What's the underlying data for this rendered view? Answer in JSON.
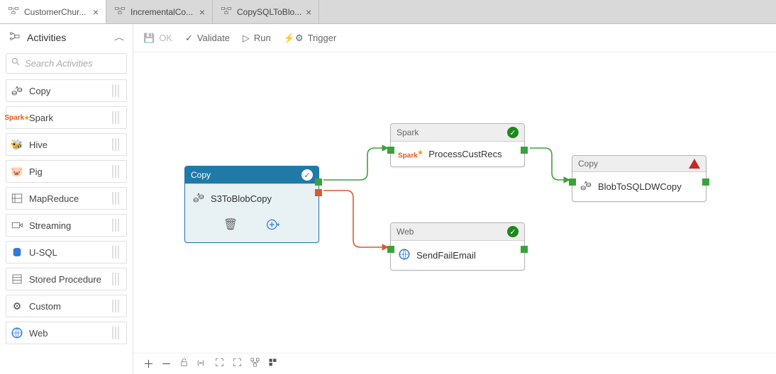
{
  "tabs": [
    {
      "label": "CustomerChur...",
      "closable": true,
      "active": true
    },
    {
      "label": "IncrementalCo...",
      "closable": true,
      "active": false
    },
    {
      "label": "CopySQLToBlo...",
      "closable": true,
      "active": false
    }
  ],
  "sidebar": {
    "title": "Activities",
    "search_placeholder": "Search Activities",
    "items": [
      {
        "label": "Copy",
        "icon": "copy"
      },
      {
        "label": "Spark",
        "icon": "spark"
      },
      {
        "label": "Hive",
        "icon": "hive"
      },
      {
        "label": "Pig",
        "icon": "pig"
      },
      {
        "label": "MapReduce",
        "icon": "mapreduce"
      },
      {
        "label": "Streaming",
        "icon": "streaming"
      },
      {
        "label": "U-SQL",
        "icon": "usql"
      },
      {
        "label": "Stored Procedure",
        "icon": "sproc"
      },
      {
        "label": "Custom",
        "icon": "custom"
      },
      {
        "label": "Web",
        "icon": "web"
      }
    ]
  },
  "toolbar": {
    "ok": "OK",
    "validate": "Validate",
    "run": "Run",
    "trigger": "Trigger"
  },
  "nodes": {
    "s3copy": {
      "type": "Copy",
      "name": "S3ToBlobCopy",
      "status": "ok",
      "selected": true
    },
    "spark": {
      "type": "Spark",
      "name": "ProcessCustRecs",
      "status": "ok",
      "selected": false
    },
    "web": {
      "type": "Web",
      "name": "SendFailEmail",
      "status": "ok",
      "selected": false
    },
    "blobcopy": {
      "type": "Copy",
      "name": "BlobToSQLDWCopy",
      "status": "warn",
      "selected": false
    }
  },
  "bottombar": {
    "icons": [
      "plus",
      "minus",
      "lock",
      "fit",
      "fullscreen",
      "actual",
      "autolayout",
      "snap"
    ]
  }
}
